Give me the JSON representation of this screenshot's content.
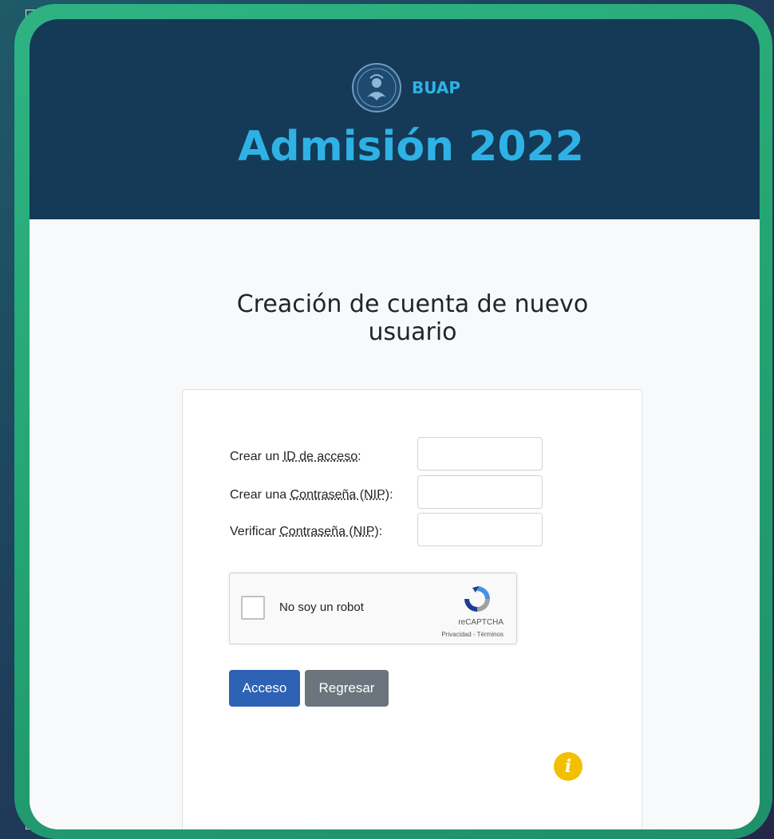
{
  "header": {
    "brand": "BUAP",
    "title": "Admisión 2022",
    "logo_icon": "buap-seal-icon",
    "accent_color": "#2eb2e5",
    "background_color": "#143a57"
  },
  "page": {
    "heading": "Creación de cuenta de nuevo usuario"
  },
  "form": {
    "id_label_prefix": "Crear un",
    "id_label_abbr": "ID de acceso",
    "id_label_suffix": ":",
    "id_value": "",
    "pwd_label_prefix": "Crear una",
    "pwd_label_abbr": "Contraseña (NIP)",
    "pwd_label_suffix": ":",
    "pwd_value": "",
    "verify_label_prefix": "Verificar",
    "verify_label_abbr": "Contraseña (NIP)",
    "verify_label_suffix": ":",
    "verify_value": ""
  },
  "recaptcha": {
    "label": "No soy un robot",
    "brand": "reCAPTCHA",
    "links": "Privacidad - Términos",
    "checked": false,
    "icon": "recaptcha-icon"
  },
  "buttons": {
    "submit": "Acceso",
    "back": "Regresar",
    "submit_color": "#2e62b4",
    "back_color": "#6c757d"
  },
  "info": {
    "icon": "info-icon",
    "glyph": "i",
    "color": "#f2c000"
  }
}
